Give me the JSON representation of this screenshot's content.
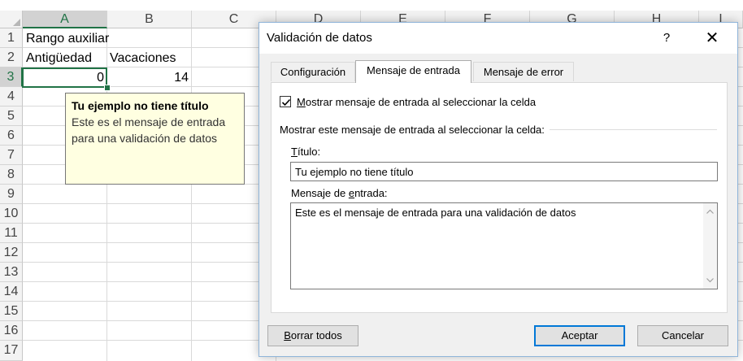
{
  "sheet": {
    "columns": [
      "A",
      "B",
      "C",
      "D",
      "E",
      "F",
      "G",
      "H",
      "I"
    ],
    "rows": [
      "1",
      "2",
      "3",
      "4",
      "5",
      "6",
      "7",
      "8",
      "9",
      "10",
      "11",
      "12",
      "13",
      "14",
      "15",
      "16",
      "17"
    ],
    "cells": {
      "a1": "Rango auxiliar",
      "a2": "Antigüedad",
      "b2": "Vacaciones",
      "a3": "0",
      "b3": "14"
    },
    "selected_cell": "A3",
    "accent_color": "#217346"
  },
  "tooltip": {
    "title": "Tu ejemplo no tiene título",
    "message": "Este es el mensaje de entrada\npara una validación de datos",
    "background": "#ffffe1"
  },
  "dialog": {
    "title": "Validación de datos",
    "help_label": "?",
    "close_label": "✕",
    "tabs": [
      {
        "label": "Configuración",
        "active": false
      },
      {
        "label": "Mensaje de entrada",
        "active": true
      },
      {
        "label": "Mensaje de error",
        "active": false
      }
    ],
    "show_checkbox": {
      "checked": true,
      "label_prefix": "M",
      "label_rest": "ostrar mensaje de entrada al seleccionar la celda"
    },
    "group_label": "Mostrar este mensaje de entrada al seleccionar la celda:",
    "title_field": {
      "label_prefix": "T",
      "label_rest": "ítulo:",
      "value": "Tu ejemplo no tiene título"
    },
    "message_field": {
      "label_before": "Mensaje de ",
      "label_underlined": "e",
      "label_after": "ntrada:",
      "value": "Este es el mensaje de entrada para una validación de datos"
    },
    "buttons": {
      "clear_prefix": "B",
      "clear_rest": "orrar todos",
      "ok": "Aceptar",
      "cancel": "Cancelar"
    },
    "default_button_color": "#0078d7"
  }
}
